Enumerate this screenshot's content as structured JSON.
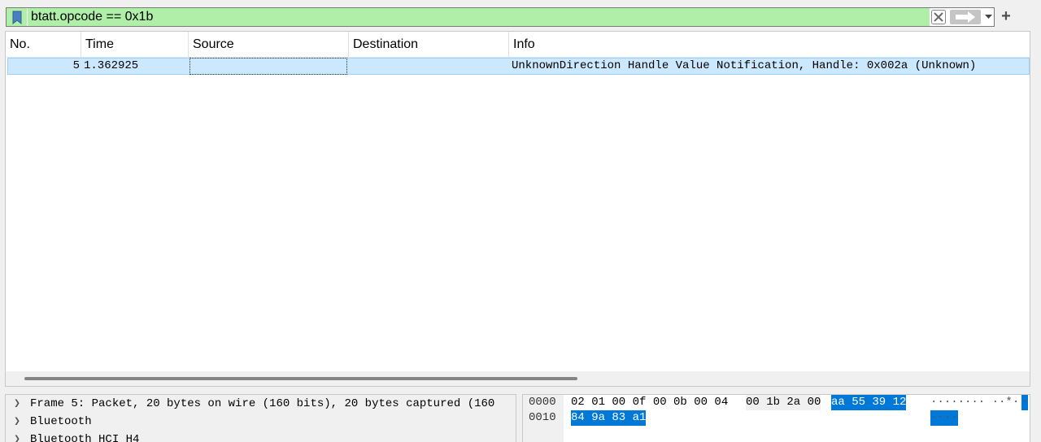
{
  "filter": {
    "value": "btatt.opcode == 0x1b",
    "bookmark_icon": "bookmark-icon",
    "clear_icon": "clear-icon",
    "apply_icon": "arrow-right-icon",
    "dropdown_icon": "chevron-down-icon",
    "add_label": "+",
    "valid_color": "#afefa8"
  },
  "packet_list": {
    "columns": [
      "No.",
      "Time",
      "Source",
      "Destination",
      "Info"
    ],
    "rows": [
      {
        "no": "5",
        "time": "1.362925",
        "source": "",
        "destination": "",
        "info": "UnknownDirection Handle Value Notification, Handle: 0x002a (Unknown)"
      }
    ],
    "selected_color": "#cce8ff"
  },
  "details": {
    "items": [
      "Frame 5: Packet, 20 bytes on wire (160 bits), 20 bytes captured (160",
      "Bluetooth",
      "Bluetooth HCI H4"
    ]
  },
  "bytes": {
    "rows": [
      {
        "offset": "0000",
        "hex_plain": "02 01 00 0f 00 0b 00 04",
        "hex_plain2": "00 1b 2a 00",
        "hex_hl": "aa 55 39 12",
        "ascii_plain": "········ ··*·",
        "ascii_hl": "·"
      },
      {
        "offset": "0010",
        "hex_plain": "",
        "hex_plain2": "",
        "hex_hl": "84 9a 83 a1",
        "ascii_plain": "",
        "ascii_hl": "····"
      }
    ],
    "highlight_color": "#0078d7"
  }
}
